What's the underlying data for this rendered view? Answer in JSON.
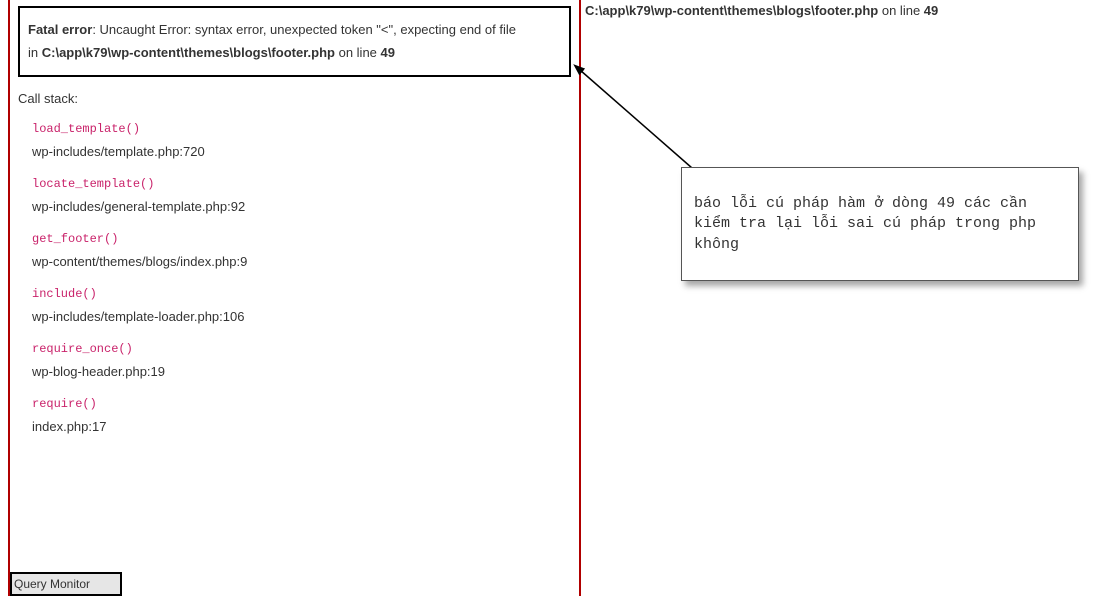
{
  "error": {
    "label": "Fatal error",
    "message_prefix": ": Uncaught Error: syntax error, unexpected token \"<\", expecting end of file",
    "in_word": "in ",
    "filepath": "C:\\app\\k79\\wp-content\\themes\\blogs\\footer.php",
    "online_word": " on line ",
    "line": "49"
  },
  "callstack_label": "Call stack:",
  "stack": [
    {
      "fn": "load_template()",
      "loc": "wp-includes/template.php:720"
    },
    {
      "fn": "locate_template()",
      "loc": "wp-includes/general-template.php:92"
    },
    {
      "fn": "get_footer()",
      "loc": "wp-content/themes/blogs/index.php:9"
    },
    {
      "fn": "include()",
      "loc": "wp-includes/template-loader.php:106"
    },
    {
      "fn": "require_once()",
      "loc": "wp-blog-header.php:19"
    },
    {
      "fn": "require()",
      "loc": "index.php:17"
    }
  ],
  "qm_label": "Query Monitor",
  "top_right": {
    "path": "C:\\app\\k79\\wp-content\\themes\\blogs\\footer.php",
    "online": " on line ",
    "line": "49"
  },
  "annotation": "báo lỗi cú pháp hàm ở dòng 49 các  cần kiểm tra lại lỗi  sai cú pháp trong php không"
}
